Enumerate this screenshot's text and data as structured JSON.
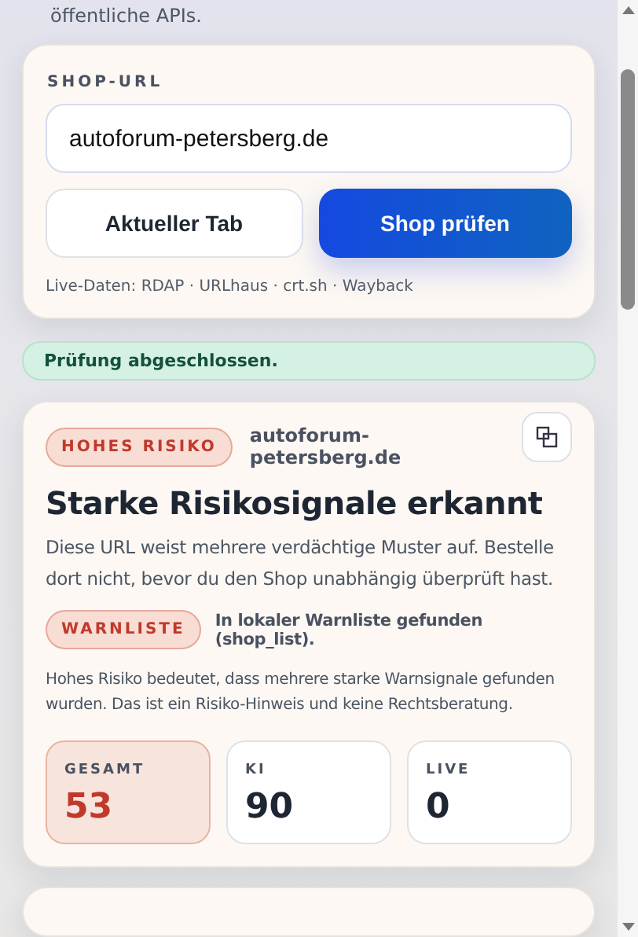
{
  "intro": "öffentliche APIs.",
  "shop_form": {
    "label": "SHOP-URL",
    "url_value": "autoforum-petersberg.de",
    "buttons": [
      {
        "label": "Aktueller Tab",
        "kind": "secondary"
      },
      {
        "label": "Shop prüfen",
        "kind": "primary"
      }
    ],
    "sources": "Live-Daten: RDAP · URLhaus · crt.sh · Wayback"
  },
  "status": "Prüfung abgeschlossen.",
  "result": {
    "badge": "HOHES RISIKO",
    "domain": "autoforum-petersberg.de",
    "title": "Starke Risikosignale erkannt",
    "summary": "Diese URL weist mehrere verdächtige Muster auf. Bestelle dort nicht, bevor du den Shop unabhängig überprüft hast.",
    "warning": {
      "badge": "WARNLISTE",
      "text": "In lokaler Warnliste gefunden (shop_list)."
    },
    "note": "Hohes Risiko bedeutet, dass mehrere starke Warnsignale gefunden wurden. Das ist ein Risiko-Hinweis und keine Rechtsberatung.",
    "scores": [
      {
        "label": "GESAMT",
        "value": "53",
        "kind": "risk"
      },
      {
        "label": "KI",
        "value": "90",
        "kind": "neutral"
      },
      {
        "label": "LIVE",
        "value": "0",
        "kind": "neutral"
      }
    ]
  }
}
